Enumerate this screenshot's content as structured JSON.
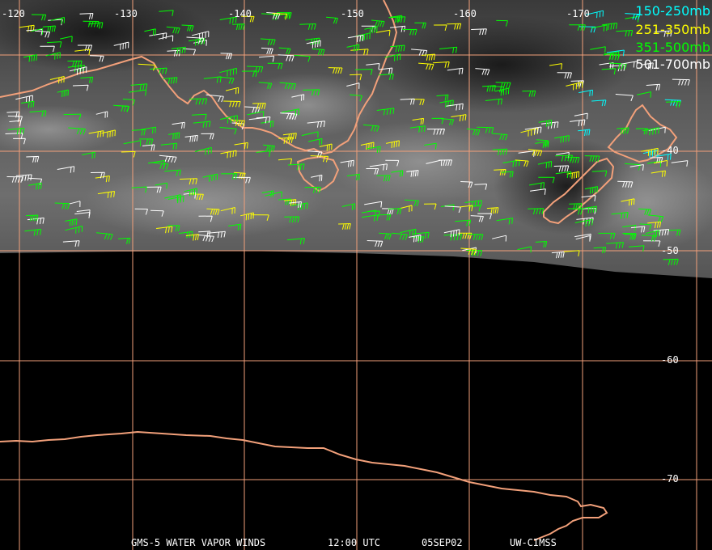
{
  "legend": [
    {
      "label": "150-250mb",
      "color": "#00ffff"
    },
    {
      "label": "251-350mb",
      "color": "#ffff00"
    },
    {
      "label": "351-500mb",
      "color": "#00ff00"
    },
    {
      "label": "501-700mb",
      "color": "#ffffff"
    }
  ],
  "lon_labels": [
    "-120",
    "-130",
    "-140",
    "-150",
    "-160",
    "-170"
  ],
  "lat_labels": [
    "-40",
    "-50",
    "-60",
    "-70"
  ],
  "footer": {
    "product": "GMS-5 WATER VAPOR WINDS",
    "time": "12:00 UTC",
    "date": "05SEP02",
    "source": "UW-CIMSS"
  },
  "colors": {
    "grid": "#f2a07a",
    "coast": "#f2a07a",
    "background": "#000000"
  }
}
